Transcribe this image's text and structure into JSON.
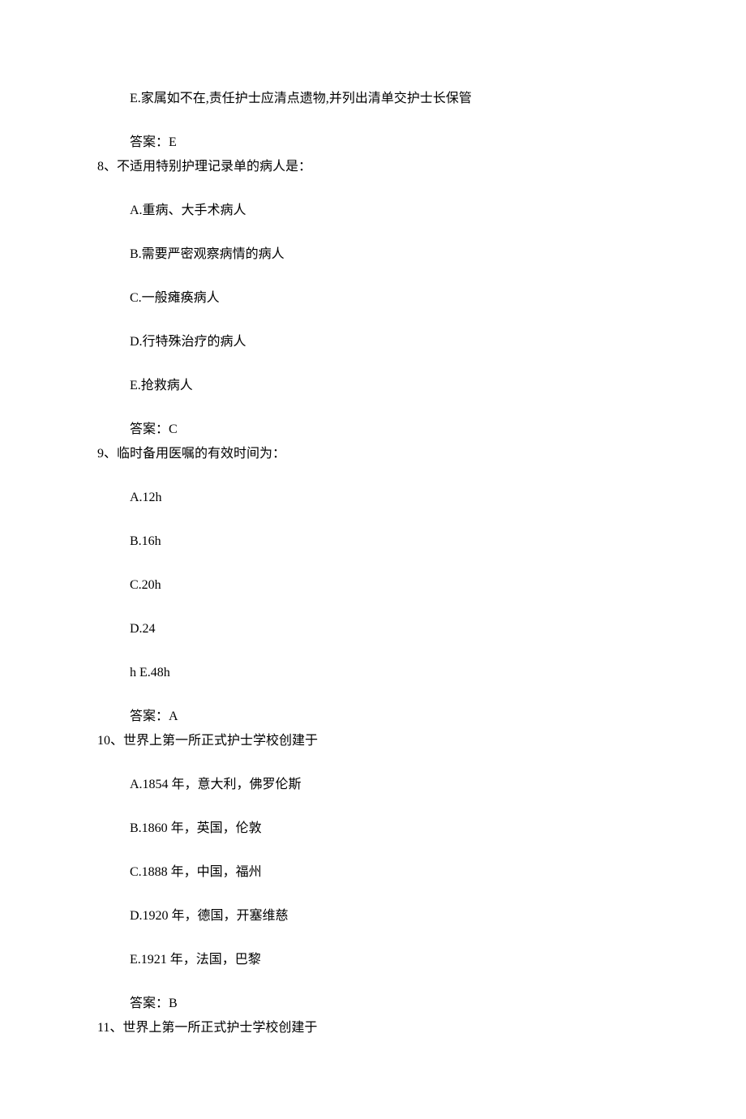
{
  "q7_remainder": {
    "option_e": "E.家属如不在,责任护士应清点遗物,并列出清单交护士长保管",
    "answer": "答案：E"
  },
  "q8": {
    "stem": "8、不适用特别护理记录单的病人是：",
    "a": "A.重病、大手术病人",
    "b": "B.需要严密观察病情的病人",
    "c": "C.一般瘫痪病人",
    "d": "D.行特殊治疗的病人",
    "e": "E.抢救病人",
    "answer": "答案：C"
  },
  "q9": {
    "stem": "9、临时备用医嘱的有效时间为：",
    "a": "A.12h",
    "b": "B.16h",
    "c": "C.20h",
    "d": "D.24",
    "e": "h E.48h",
    "answer": "答案：A"
  },
  "q10": {
    "stem": "10、世界上第一所正式护士学校创建于",
    "a": "A.1854 年，意大利，佛罗伦斯",
    "b": "B.1860 年，英国，伦敦",
    "c": "C.1888 年，中国，福州",
    "d": "D.1920 年，德国，开塞维慈",
    "e": "E.1921 年，法国，巴黎",
    "answer": "答案：B"
  },
  "q11": {
    "stem": "11、世界上第一所正式护士学校创建于"
  }
}
